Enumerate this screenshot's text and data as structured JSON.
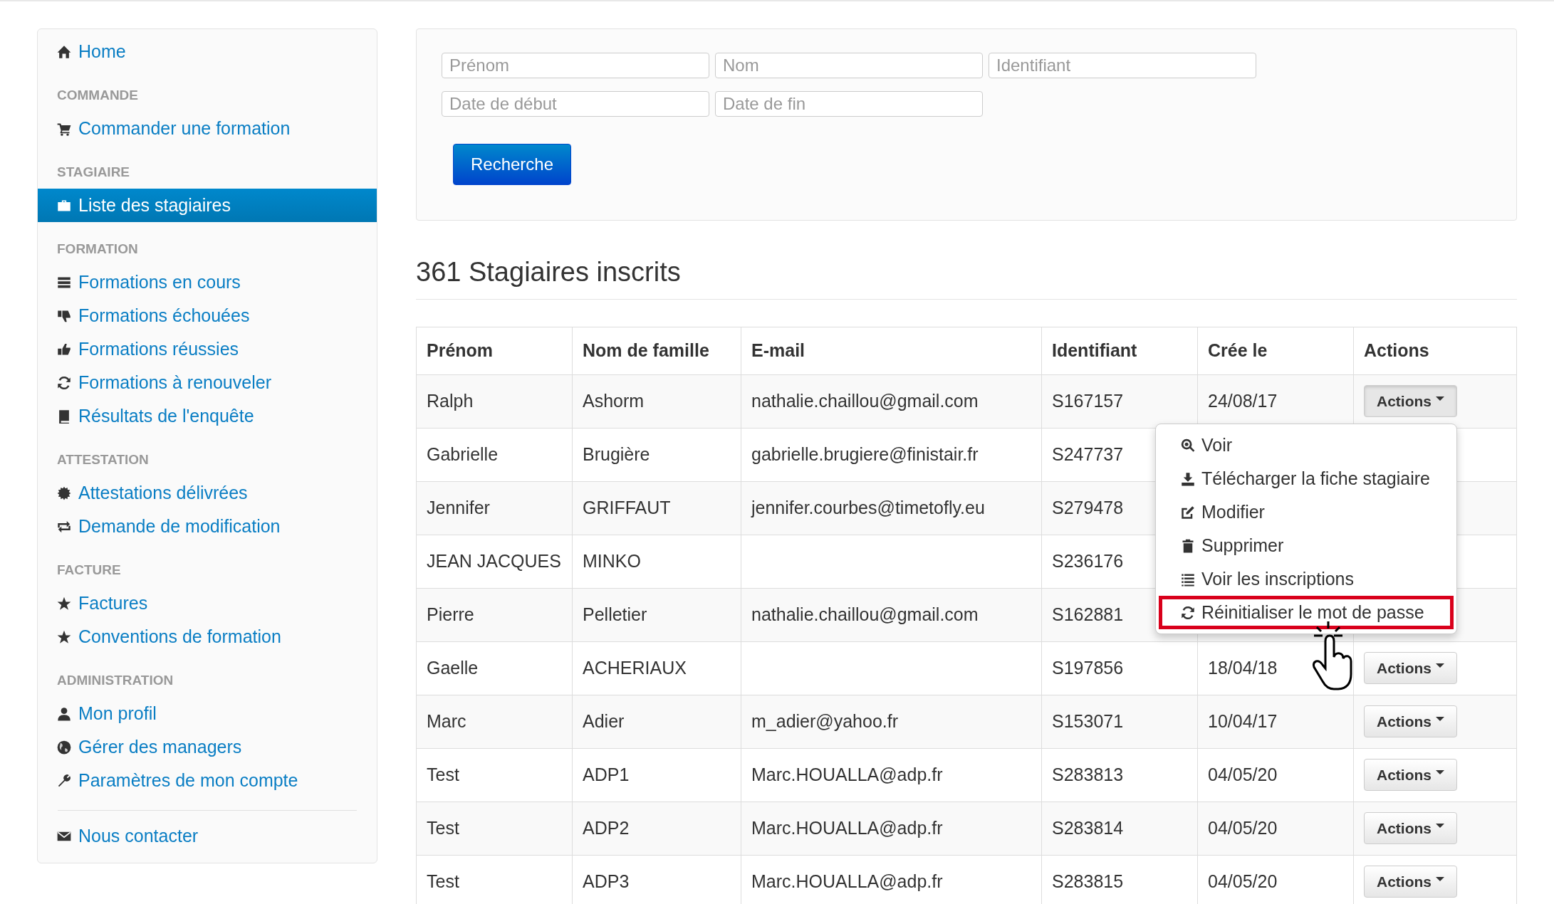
{
  "sidebar": {
    "sections": [
      {
        "items": [
          {
            "label": "Home",
            "selected": false
          }
        ]
      },
      {
        "heading": "COMMANDE",
        "items": [
          {
            "label": "Commander une formation",
            "selected": false
          }
        ]
      },
      {
        "heading": "STAGIAIRE",
        "items": [
          {
            "label": "Liste des stagiaires",
            "selected": true
          }
        ]
      },
      {
        "heading": "FORMATION",
        "items": [
          {
            "label": "Formations en cours",
            "selected": false
          },
          {
            "label": "Formations échouées",
            "selected": false
          },
          {
            "label": "Formations réussies",
            "selected": false
          },
          {
            "label": "Formations à renouveler",
            "selected": false
          },
          {
            "label": "Résultats de l'enquête",
            "selected": false
          }
        ]
      },
      {
        "heading": "ATTESTATION",
        "items": [
          {
            "label": "Attestations délivrées",
            "selected": false
          },
          {
            "label": "Demande de modification",
            "selected": false
          }
        ]
      },
      {
        "heading": "FACTURE",
        "items": [
          {
            "label": "Factures",
            "selected": false
          },
          {
            "label": "Conventions de formation",
            "selected": false
          }
        ]
      },
      {
        "heading": "ADMINISTRATION",
        "items": [
          {
            "label": "Mon profil",
            "selected": false
          },
          {
            "label": "Gérer des managers",
            "selected": false
          },
          {
            "label": "Paramètres de mon compte",
            "selected": false
          }
        ]
      },
      {
        "divider": true,
        "items": [
          {
            "label": "Nous contacter",
            "selected": false
          }
        ]
      }
    ]
  },
  "search": {
    "field_rows": [
      [
        {
          "placeholder": "Prénom"
        },
        {
          "placeholder": "Nom"
        },
        {
          "placeholder": "Identifiant"
        }
      ],
      [
        {
          "placeholder": "Date de début"
        },
        {
          "placeholder": "Date de fin"
        }
      ]
    ],
    "button": "Recherche"
  },
  "heading": "361 Stagiaires inscrits",
  "table": {
    "columns": [
      "Prénom",
      "Nom de famille",
      "E-mail",
      "Identifiant",
      "Crée le",
      "Actions"
    ],
    "rows": [
      {
        "cells": [
          "Ralph",
          "Ashorm",
          "nathalie.chaillou@gmail.com",
          "S167157",
          "24/08/17"
        ],
        "action_button": "Actions",
        "menu_open": true
      },
      {
        "cells": [
          "Gabrielle",
          "Brugière",
          "gabrielle.brugiere@finistair.fr",
          "S247737"
        ]
      },
      {
        "cells": [
          "Jennifer",
          "GRIFFAUT",
          "jennifer.courbes@timetofly.eu",
          "S279478"
        ]
      },
      {
        "cells": [
          "JEAN JACQUES",
          "MINKO",
          "",
          "S236176"
        ]
      },
      {
        "cells": [
          "Pierre",
          "Pelletier",
          "nathalie.chaillou@gmail.com",
          "S162881"
        ]
      },
      {
        "cells": [
          "Gaelle",
          "ACHERIAUX",
          "",
          "S197856",
          "18/04/18"
        ],
        "action_button": "Actions",
        "menu_open": false
      },
      {
        "cells": [
          "Marc",
          "Adier",
          "m_adier@yahoo.fr",
          "S153071",
          "10/04/17"
        ],
        "action_button": "Actions",
        "menu_open": false
      },
      {
        "cells": [
          "Test",
          "ADP1",
          "Marc.HOUALLA@adp.fr",
          "S283813",
          "04/05/20"
        ],
        "action_button": "Actions",
        "menu_open": false
      },
      {
        "cells": [
          "Test",
          "ADP2",
          "Marc.HOUALLA@adp.fr",
          "S283814",
          "04/05/20"
        ],
        "action_button": "Actions",
        "menu_open": false
      },
      {
        "cells": [
          "Test",
          "ADP3",
          "Marc.HOUALLA@adp.fr",
          "S283815",
          "04/05/20"
        ],
        "action_button": "Actions",
        "menu_open": false
      }
    ],
    "menu": [
      {
        "label": "Voir",
        "highlighted": false
      },
      {
        "label": "Télécharger la fiche stagiaire",
        "highlighted": false
      },
      {
        "label": "Modifier",
        "highlighted": false
      },
      {
        "label": "Supprimer",
        "highlighted": false
      },
      {
        "label": "Voir les inscriptions",
        "highlighted": false
      },
      {
        "label": "Réinitialiser le mot de passe",
        "highlighted": true
      }
    ]
  }
}
